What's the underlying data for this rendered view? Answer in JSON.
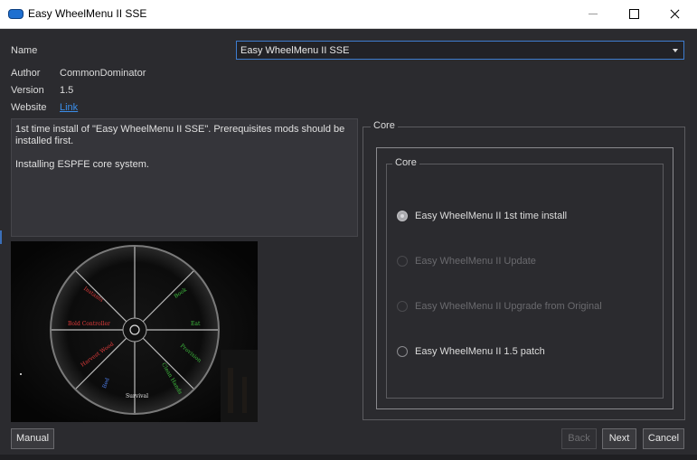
{
  "window": {
    "title": "Easy WheelMenu II SSE"
  },
  "info": {
    "name_label": "Name",
    "name_value": "Easy WheelMenu II SSE",
    "author_label": "Author",
    "author_value": "CommonDominator",
    "version_label": "Version",
    "version_value": "1.5",
    "website_label": "Website",
    "website_link": "Link"
  },
  "description": {
    "line1": "1st time install of \"Easy WheelMenu II SSE\". Prerequisites mods should be installed first.",
    "line2": "Installing ESPFE core system."
  },
  "preview": {
    "center_label": "Survival",
    "spokes": [
      {
        "label": "Instants",
        "color": "#e23b3b"
      },
      {
        "label": "Book",
        "color": "#3fbf3f"
      },
      {
        "label": "Bold Controller",
        "color": "#e23b3b"
      },
      {
        "label": "Eat",
        "color": "#3fbf3f"
      },
      {
        "label": "Harvest Wood",
        "color": "#e23b3b"
      },
      {
        "label": "Provision",
        "color": "#3fbf3f"
      },
      {
        "label": "Bed",
        "color": "#4a78e0"
      },
      {
        "label": "Clean Hands",
        "color": "#3fbf3f"
      }
    ]
  },
  "steps": {
    "outer_group": "Core",
    "inner_group": "Core",
    "options": [
      {
        "label": "Easy WheelMenu II 1st time install",
        "checked": true,
        "disabled": false
      },
      {
        "label": "Easy WheelMenu II Update",
        "checked": false,
        "disabled": true
      },
      {
        "label": "Easy WheelMenu II Upgrade from Original",
        "checked": false,
        "disabled": true
      },
      {
        "label": "Easy WheelMenu II 1.5 patch",
        "checked": false,
        "disabled": false
      }
    ]
  },
  "buttons": {
    "manual": "Manual",
    "back": "Back",
    "next": "Next",
    "cancel": "Cancel"
  }
}
